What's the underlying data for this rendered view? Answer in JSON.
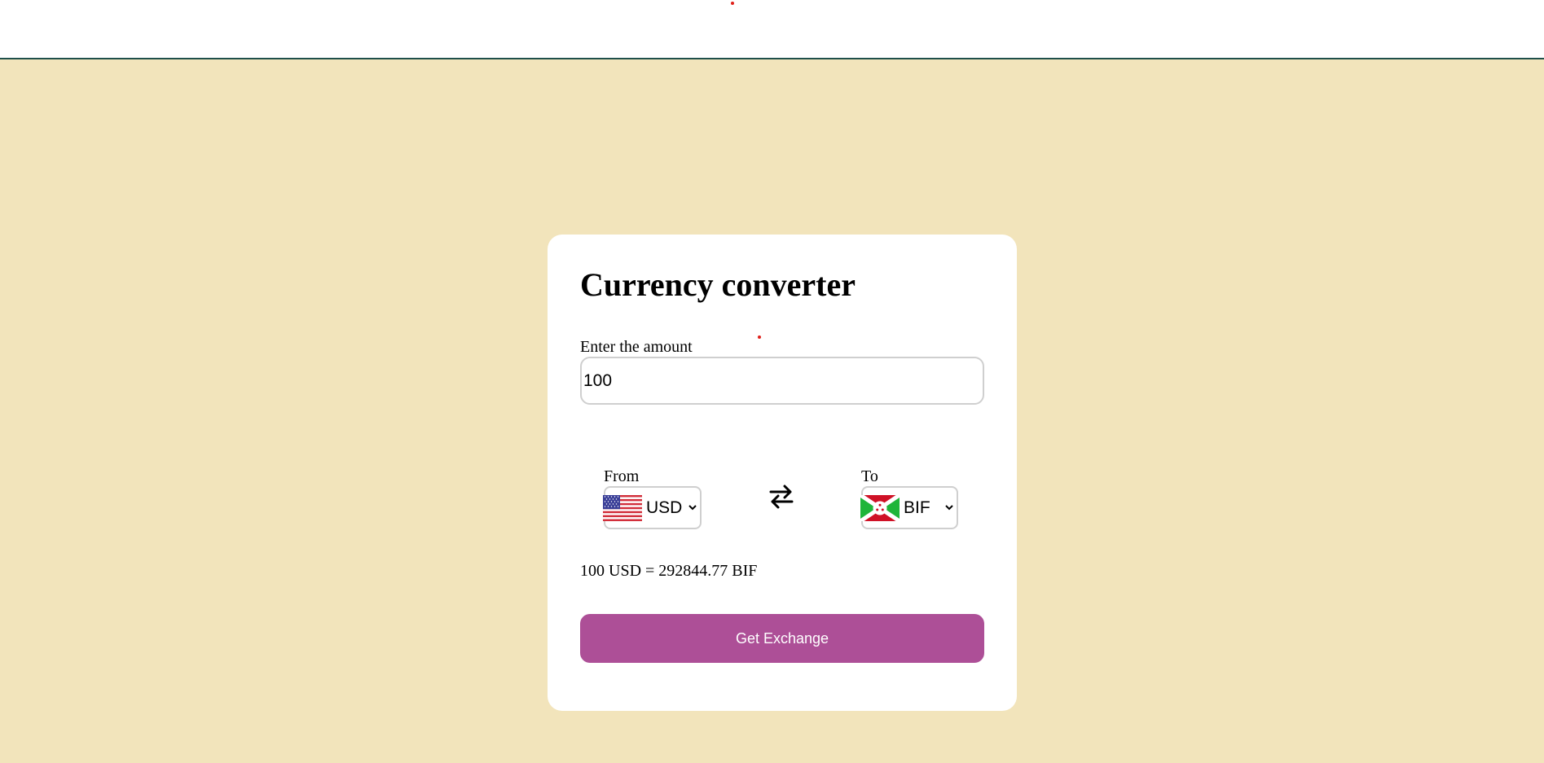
{
  "converter": {
    "title": "Currency converter",
    "amount_label": "Enter the amount",
    "amount_value": "100",
    "from_label": "From",
    "from_currency": "USD",
    "to_label": "To",
    "to_currency": "BIF",
    "result_text": "100 USD = 292844.77 BIF",
    "button_label": "Get Exchange"
  },
  "icons": {
    "from_flag": "us-flag-icon",
    "to_flag": "burundi-flag-icon",
    "swap": "swap-arrows-icon",
    "dropdown": "chevron-down-icon"
  },
  "colors": {
    "page_background": "#f2e4bb",
    "card_background": "#ffffff",
    "button_background": "#ad4f97",
    "button_text": "#ffffff",
    "header_border": "#1f4f4a",
    "input_border": "#cfcfcf"
  }
}
